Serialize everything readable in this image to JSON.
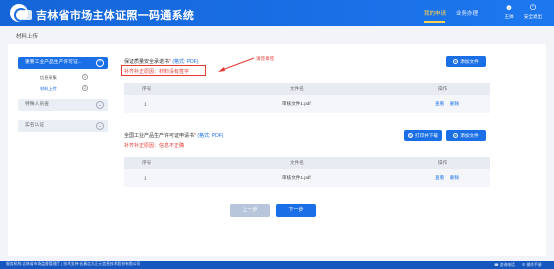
{
  "header": {
    "site_title": "吉林省市场主体证照一码通系统",
    "nav": [
      "我的申请",
      "业务办理"
    ],
    "icons": [
      {
        "name": "user-icon",
        "label": "王帅"
      },
      {
        "name": "logout-icon",
        "label": "安全退出"
      }
    ],
    "accent": "#ffd34d",
    "brand": "#1a6fe6"
  },
  "page_title": "材料上传",
  "sidebar": {
    "steps": [
      {
        "label": "重要工业产品生产许可证...",
        "state": "active"
      },
      {
        "label": "特殊人员查",
        "state": "inactive"
      },
      {
        "label": "实名认证",
        "state": "inactive"
      }
    ],
    "substeps": [
      {
        "label": "信息采集",
        "num": "1"
      },
      {
        "label": "材料上传",
        "num": "2"
      }
    ]
  },
  "section1": {
    "label": "保证质量安全承诺书",
    "req_marker": "*",
    "format": "(格式: PDF)",
    "error": "补齐补正原因：材料没有签字",
    "annotation": "请签章签",
    "add_button": "添加文件",
    "columns": [
      "序号",
      "文件名",
      "操作"
    ],
    "rows": [
      {
        "index": "1",
        "filename": "审核文件1.pdf",
        "actions": [
          "查看",
          "删除"
        ]
      }
    ]
  },
  "section2": {
    "label": "全国工业产品生产许可证申请书",
    "req_marker": "*",
    "format": "(格式: PDF)",
    "error": "补齐补正原因：信息不正确",
    "print_button": "打印并下载",
    "add_button": "添加文件",
    "columns": [
      "序号",
      "文件名",
      "操作"
    ],
    "rows": [
      {
        "index": "1",
        "filename": "审核文件1.pdf",
        "actions": [
          "查看",
          "删除"
        ]
      }
    ]
  },
  "pager": {
    "prev": "上一步",
    "next": "下一步"
  },
  "footer": {
    "text": "服务机构:吉林省市场监督管理厅 | 技术支持:长春吉大正元信息技术股份有限公司",
    "right": [
      "咨询电话",
      "操作手册"
    ]
  }
}
